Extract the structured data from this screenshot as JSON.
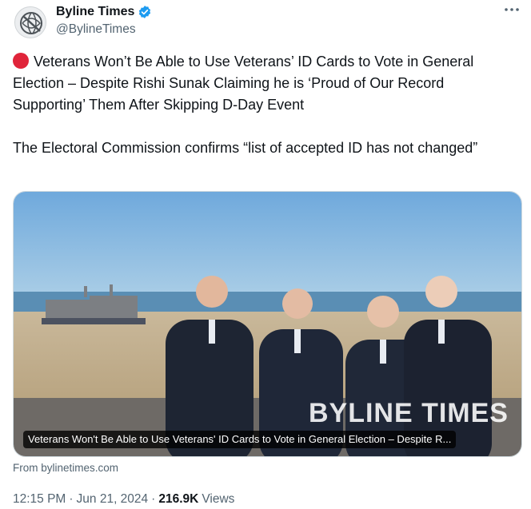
{
  "account": {
    "display_name": "Byline Times",
    "handle": "@BylineTimes",
    "verified_color": "#1d9bf0"
  },
  "tweet": {
    "paragraph1": "Veterans Won’t Be Able to Use Veterans’ ID Cards to Vote in General Election – Despite Rishi Sunak Claiming he is ‘Proud of Our Record Supporting’ Them After Skipping D-Day Event",
    "paragraph2": "The Electoral Commission confirms “list of accepted ID has not changed”",
    "leading_emoji": "red-circle"
  },
  "card": {
    "caption": "Veterans Won't Be Able to Use Veterans' ID Cards to Vote in General Election – Despite R...",
    "watermark": "BYLINE TIMES",
    "source": "From bylinetimes.com"
  },
  "meta": {
    "time": "12:15 PM",
    "separator1": "·",
    "date": "Jun 21, 2024",
    "separator2": "·",
    "views_count": "216.9K",
    "views_label": "Views"
  },
  "icons": {
    "more": "more-options-icon",
    "verified": "verified-badge-icon"
  }
}
